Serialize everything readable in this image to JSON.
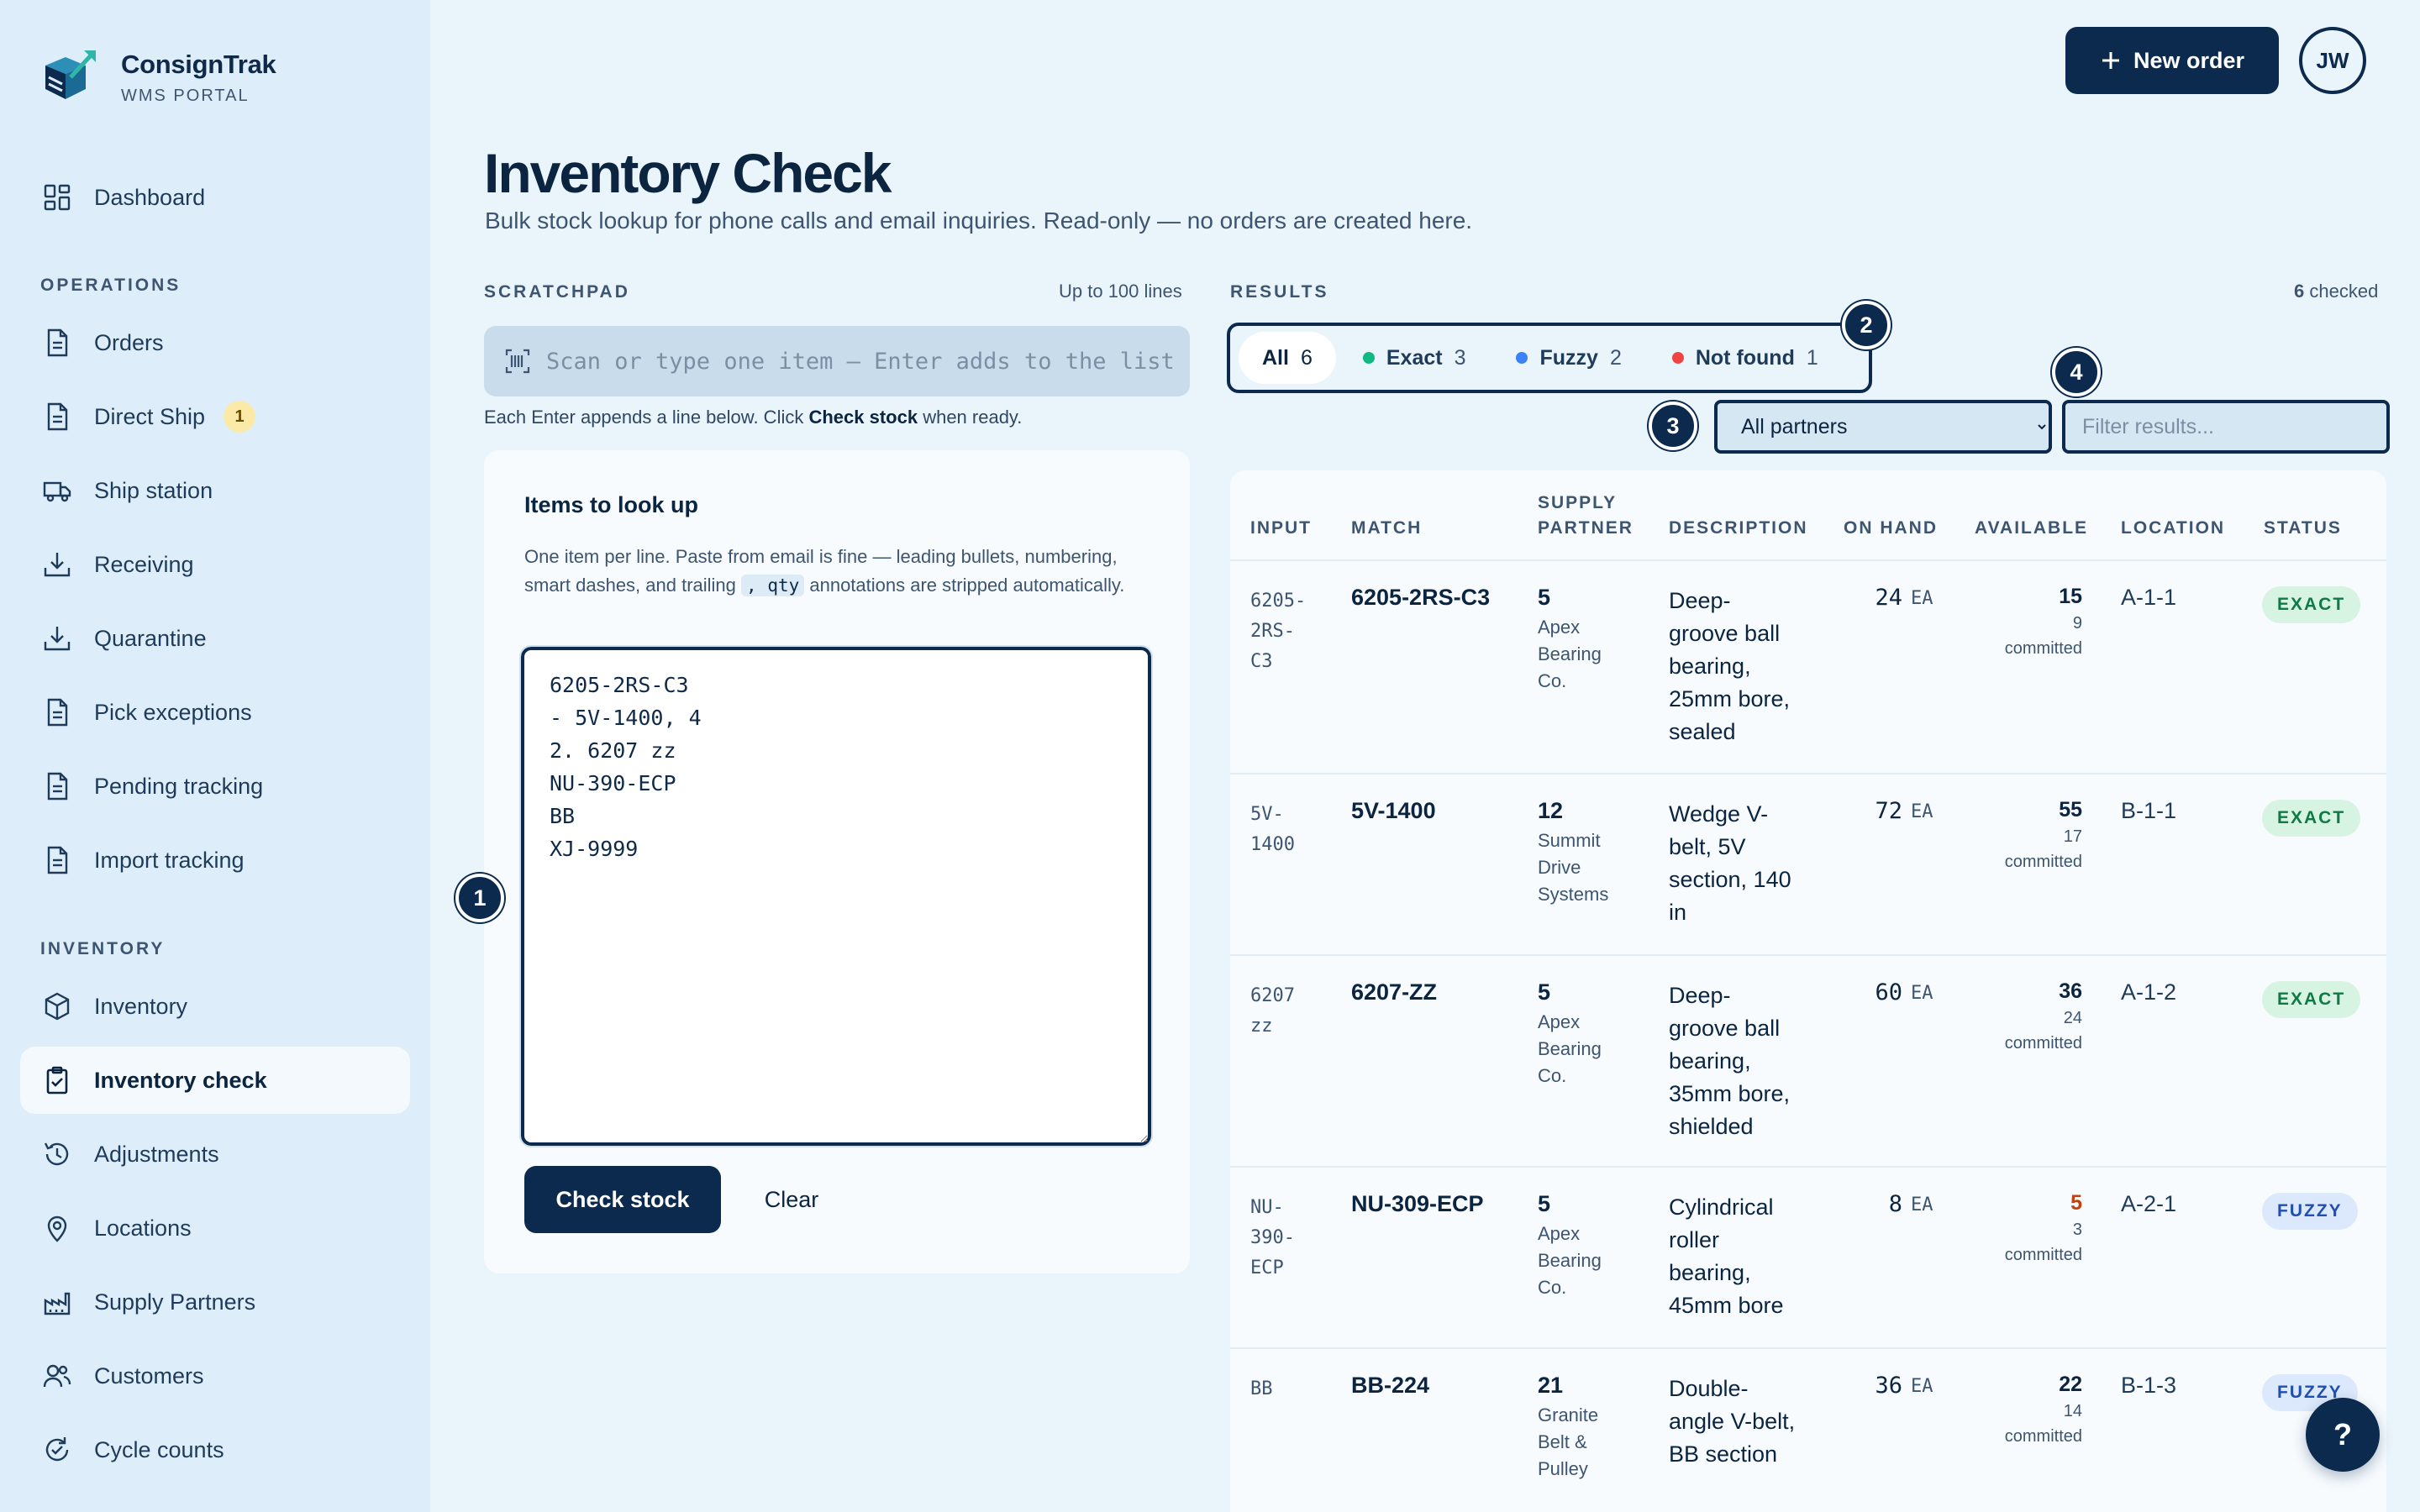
{
  "brand": {
    "name": "ConsignTrak",
    "sub": "WMS PORTAL"
  },
  "nav": {
    "dashboard": "Dashboard",
    "operations_label": "OPERATIONS",
    "operations": [
      {
        "label": "Orders",
        "icon": "document-icon"
      },
      {
        "label": "Direct Ship",
        "icon": "document-icon",
        "badge": "1"
      },
      {
        "label": "Ship station",
        "icon": "truck-icon"
      },
      {
        "label": "Receiving",
        "icon": "download-icon"
      },
      {
        "label": "Quarantine",
        "icon": "download-icon"
      },
      {
        "label": "Pick exceptions",
        "icon": "document-icon"
      },
      {
        "label": "Pending tracking",
        "icon": "document-icon"
      },
      {
        "label": "Import tracking",
        "icon": "document-icon"
      }
    ],
    "inventory_label": "INVENTORY",
    "inventory": [
      {
        "label": "Inventory",
        "icon": "cube-icon"
      },
      {
        "label": "Inventory check",
        "icon": "clipboard-check-icon",
        "active": true
      },
      {
        "label": "Adjustments",
        "icon": "history-icon"
      },
      {
        "label": "Locations",
        "icon": "map-pin-icon"
      },
      {
        "label": "Supply Partners",
        "icon": "factory-icon"
      },
      {
        "label": "Customers",
        "icon": "users-icon"
      },
      {
        "label": "Cycle counts",
        "icon": "refresh-check-icon"
      }
    ]
  },
  "topbar": {
    "new_order": "New order",
    "avatar": "JW"
  },
  "page": {
    "title": "Inventory Check",
    "subtitle": "Bulk stock lookup for phone calls and email inquiries. Read-only — no orders are created here."
  },
  "scratchpad": {
    "label": "SCRATCHPAD",
    "limit": "Up to 100 lines",
    "placeholder": "Scan or type one item — Enter adds to the list",
    "hint_pre": "Each Enter appends a line below. Click ",
    "hint_bold": "Check stock",
    "hint_post": " when ready.",
    "card_title": "Items to look up",
    "card_desc_pre": "One item per line. Paste from email is fine — leading bullets, numbering, smart dashes, and trailing ",
    "card_desc_code": ", qty",
    "card_desc_post": " annotations are stripped automatically.",
    "lines": "6205-2RS-C3\n- 5V-1400, 4\n2. 6207 zz\nNU-390-ECP\nBB\nXJ-9999",
    "check_button": "Check stock",
    "clear_button": "Clear"
  },
  "results": {
    "label": "RESULTS",
    "checked_count": "6",
    "checked_label": "checked",
    "tabs": [
      {
        "label": "All",
        "count": "6",
        "active": true
      },
      {
        "label": "Exact",
        "count": "3",
        "dot": "#10b981"
      },
      {
        "label": "Fuzzy",
        "count": "2",
        "dot": "#3b82f6"
      },
      {
        "label": "Not found",
        "count": "1",
        "dot": "#ef4444"
      }
    ],
    "partner_select": "All partners",
    "filter_placeholder": "Filter results...",
    "columns": {
      "input": "INPUT",
      "match": "MATCH",
      "supply_partner": "SUPPLY\nPARTNER",
      "description": "DESCRIPTION",
      "on_hand": "ON HAND",
      "available": "AVAILABLE",
      "location": "LOCATION",
      "status": "STATUS"
    },
    "rows": [
      {
        "input": "6205-\n2RS-\nC3",
        "match": "6205-2RS-C3",
        "partner_num": "5",
        "partner_name": "Apex\nBearing\nCo.",
        "description": "Deep-\ngroove ball\nbearing,\n25mm bore,\nsealed",
        "on_hand": "24",
        "uom": "EA",
        "available": "15",
        "committed": "9\ncommitted",
        "location": "A-1-1",
        "status": "EXACT"
      },
      {
        "input": "5V-\n1400",
        "match": "5V-1400",
        "partner_num": "12",
        "partner_name": "Summit\nDrive\nSystems",
        "description": "Wedge V-\nbelt, 5V\nsection, 140\nin",
        "on_hand": "72",
        "uom": "EA",
        "available": "55",
        "committed": "17\ncommitted",
        "location": "B-1-1",
        "status": "EXACT"
      },
      {
        "input": "6207\nzz",
        "match": "6207-ZZ",
        "partner_num": "5",
        "partner_name": "Apex\nBearing\nCo.",
        "description": "Deep-\ngroove ball\nbearing,\n35mm bore,\nshielded",
        "on_hand": "60",
        "uom": "EA",
        "available": "36",
        "committed": "24\ncommitted",
        "location": "A-1-2",
        "status": "EXACT"
      },
      {
        "input": "NU-\n390-\nECP",
        "match": "NU-309-ECP",
        "partner_num": "5",
        "partner_name": "Apex\nBearing\nCo.",
        "description": "Cylindrical\nroller\nbearing,\n45mm bore",
        "on_hand": "8",
        "uom": "EA",
        "available": "5",
        "available_warn": true,
        "committed": "3\ncommitted",
        "location": "A-2-1",
        "status": "FUZZY"
      },
      {
        "input": "BB",
        "match": "BB-224",
        "partner_num": "21",
        "partner_name": "Granite\nBelt &\nPulley",
        "description": "Double-\nangle V-belt,\nBB section",
        "on_hand": "36",
        "uom": "EA",
        "available": "22",
        "committed": "14\ncommitted",
        "location": "B-1-3",
        "status": "FUZZY"
      }
    ]
  },
  "markers": [
    "1",
    "2",
    "3",
    "4"
  ],
  "help": "?",
  "colors": {
    "primary": "#0c2a4e",
    "exact": "#10b981",
    "fuzzy": "#3b82f6",
    "not_found": "#ef4444",
    "warn": "#c2410c"
  }
}
